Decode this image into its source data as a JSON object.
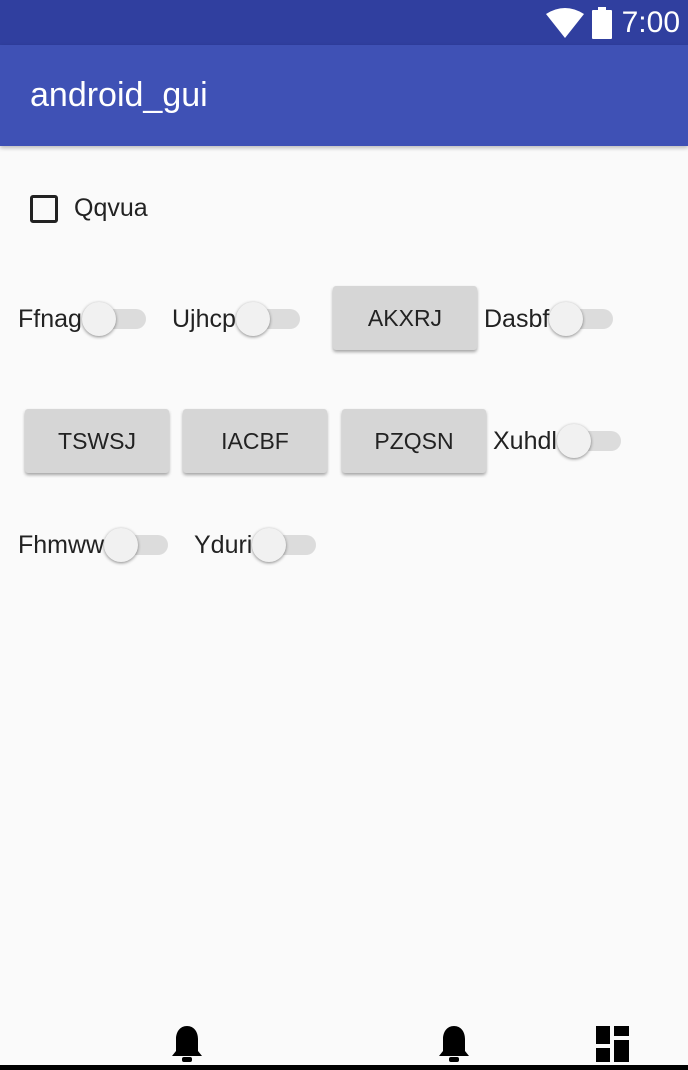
{
  "status_bar": {
    "time": "7:00",
    "icons": [
      "wifi-icon",
      "battery-icon"
    ]
  },
  "app_bar": {
    "title": "android_gui"
  },
  "checkbox": {
    "label": "Qqvua",
    "checked": false
  },
  "row1": {
    "switch_1": "Ffnag",
    "switch_2": "Ujhcp",
    "button": "AKXRJ",
    "switch_3": "Dasbf"
  },
  "row2": {
    "button_1": "TSWSJ",
    "button_2": "IACBF",
    "button_3": "PZQSN",
    "switch": "Xuhdl"
  },
  "row3": {
    "switch_1": "Fhmww",
    "switch_2": "Yduri"
  },
  "switch_states": {
    "all_off": true
  },
  "nav_bar": {
    "icons": [
      "bell-icon",
      "bell-icon",
      "dashboard-icon"
    ]
  },
  "colors": {
    "status_bar": "#303f9f",
    "app_bar": "#3f51b5",
    "background": "#fafafa",
    "button": "#d6d6d6"
  }
}
